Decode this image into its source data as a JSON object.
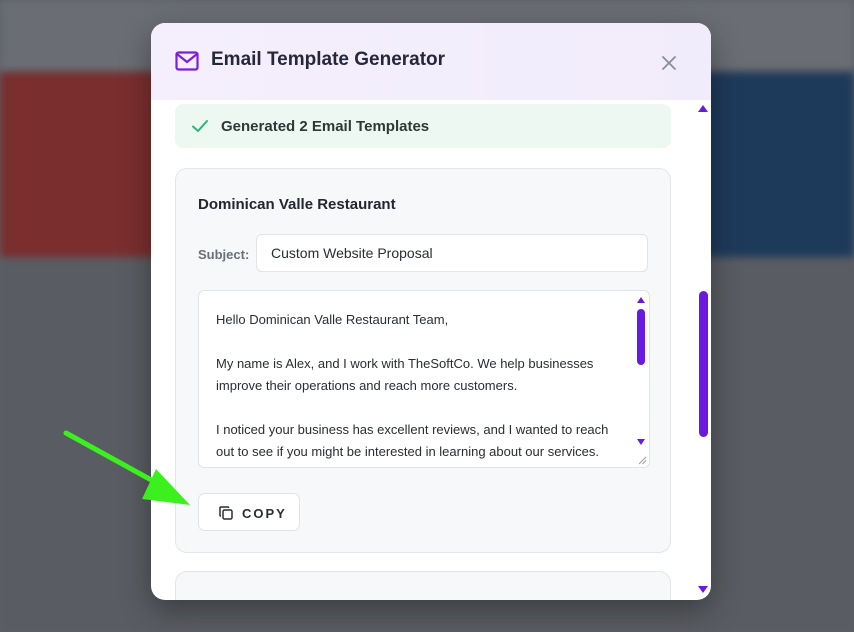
{
  "modal": {
    "title": "Email Template Generator",
    "close_label": "×"
  },
  "status": {
    "message": "Generated 2 Email Templates"
  },
  "template": {
    "business_name": "Dominican Valle Restaurant",
    "subject_label": "Subject:",
    "subject_value": "Custom Website Proposal",
    "body_paragraphs": [
      "Hello Dominican Valle Restaurant Team,",
      "My name is Alex, and I work with TheSoftCo. We help businesses improve their operations and reach more customers.",
      "I noticed your business has excellent reviews, and I wanted to reach out to see if you might be interested in learning about our services."
    ],
    "copy_label": "COPY"
  },
  "colors": {
    "accent": "#6d18e0",
    "success_check": "#2fb380",
    "annotation_arrow": "#3cf01e"
  }
}
